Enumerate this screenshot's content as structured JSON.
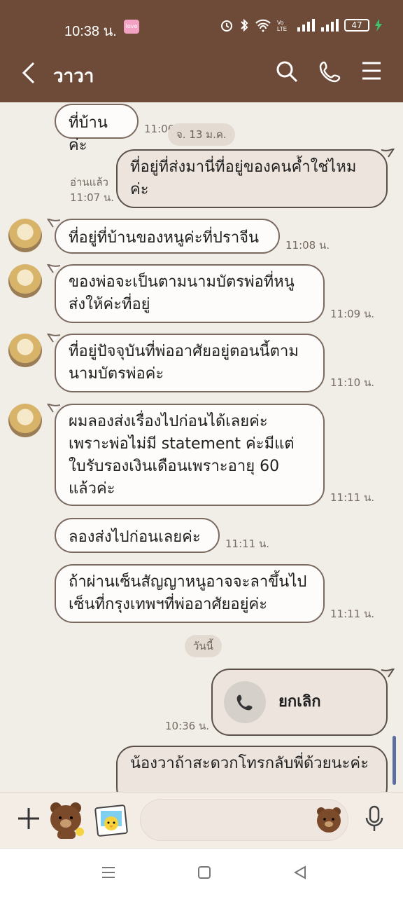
{
  "status": {
    "time": "10:38 น.",
    "love_badge": "love",
    "battery": "47"
  },
  "header": {
    "title": "วาวา"
  },
  "messages": [
    {
      "id": "m1",
      "side": "left",
      "text": "ที่บ้านค่ะ",
      "time": "11:06"
    },
    {
      "id": "m2",
      "side": "right",
      "text": "ที่อยู่ที่ส่งมานี่ที่อยู่ของคนค้ำใช่ไหมค่ะ",
      "read": "อ่านแล้ว",
      "time": "11:07 น."
    },
    {
      "id": "m3",
      "side": "left",
      "text": "ที่อยู่ที่บ้านของหนูค่ะที่ปราจีน",
      "time": "11:08 น."
    },
    {
      "id": "m4",
      "side": "left",
      "text": "ของพ่อจะเป็นตามนามบัตรพ่อที่หนูส่งให้ค่ะที่อยู่",
      "time": "11:09 น."
    },
    {
      "id": "m5",
      "side": "left",
      "text": "ที่อยู่ปัจจุบันที่พ่ออาศัยอยู่ตอนนี้ตามนามบัตรพ่อค่ะ",
      "time": "11:10 น."
    },
    {
      "id": "m6",
      "side": "left",
      "text": "ผมลองส่งเรื่องไปก่อนได้เลยค่ะ เพราะพ่อไม่มี statement ค่ะมีแต่ใบรับรองเงินเดือนเพราะอายุ 60 แล้วค่ะ",
      "time": "11:11 น."
    },
    {
      "id": "m7",
      "side": "left",
      "text": "ลองส่งไปก่อนเลยค่ะ",
      "time": "11:11 น."
    },
    {
      "id": "m8",
      "side": "left",
      "text": "ถ้าผ่านเซ็นสัญญาหนูอาจจะลาขึ้นไปเซ็นที่กรุงเทพฯที่พ่ออาศัยอยู่ค่ะ",
      "time": "11:11 น."
    },
    {
      "id": "m9",
      "side": "right",
      "type": "call",
      "text": "ยกเลิก",
      "time": "10:36 น."
    },
    {
      "id": "m10",
      "side": "right",
      "text": "น้องวาถ้าสะดวกโทรกลับพี่ด้วยนะค่ะ"
    }
  ],
  "date_pills": {
    "old": "จ. 13 ม.ค.",
    "today": "วันนี้"
  },
  "input": {
    "placeholder": ""
  },
  "icons": {
    "back": "back-arrow-icon",
    "search": "search-icon",
    "call": "phone-icon",
    "menu": "menu-icon",
    "plus": "plus-icon",
    "emoji": "bear-emoji-icon",
    "mic": "microphone-icon"
  },
  "colors": {
    "header_bg": "#6e4b38",
    "chat_bg": "#f1ede7",
    "my_bubble": "#ede5dd"
  }
}
